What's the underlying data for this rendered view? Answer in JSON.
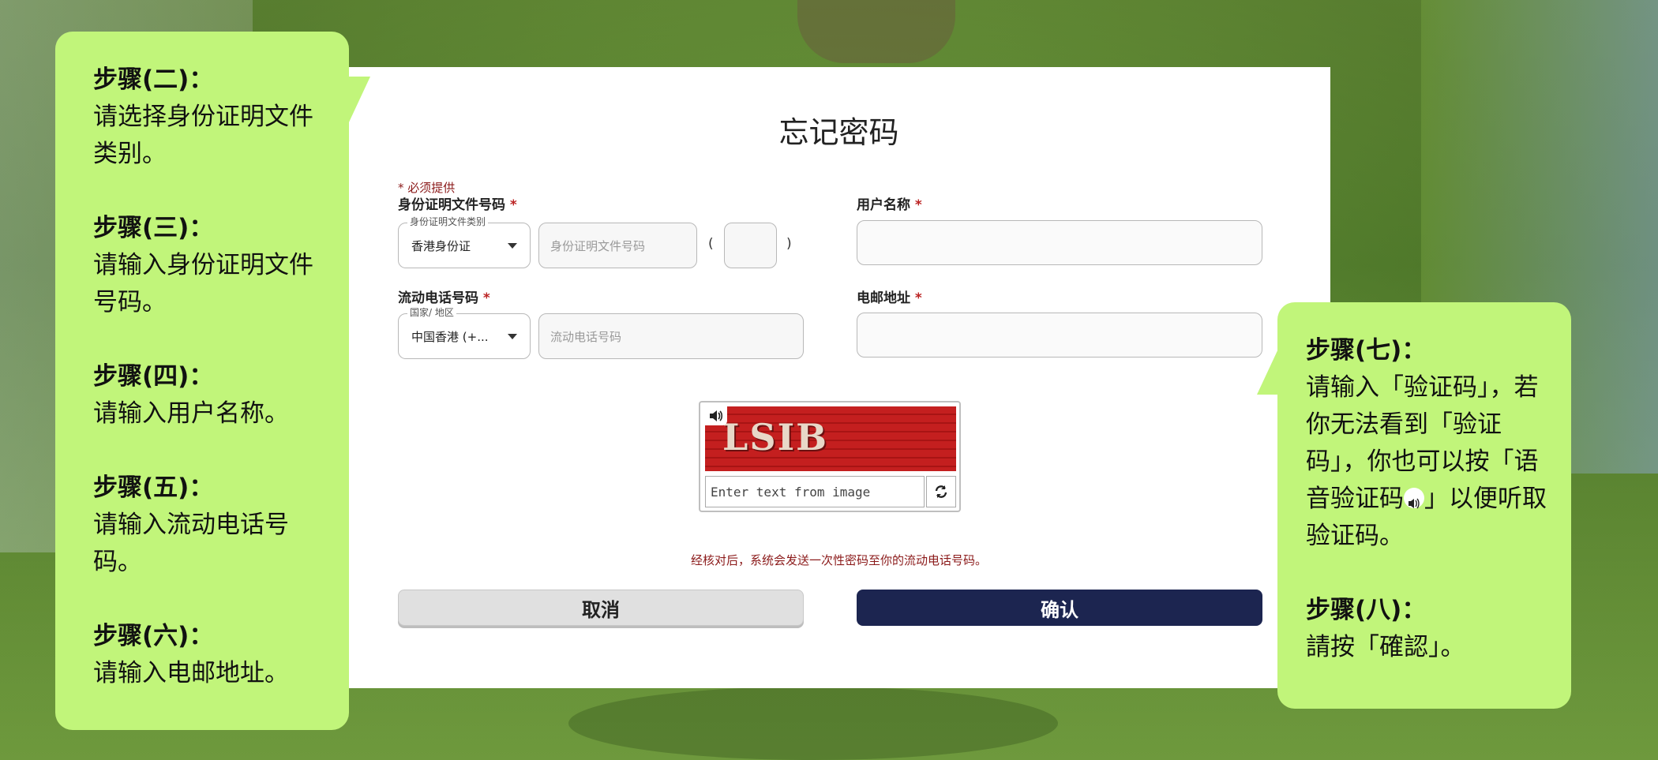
{
  "form": {
    "title": "忘记密码",
    "required_note": "* 必须提供",
    "id_label": "身份证明文件号码",
    "id_type_legend": "身份证明文件类别",
    "id_type_value": "香港身份证",
    "id_number_placeholder": "身份证明文件号码",
    "paren_open": "(",
    "paren_close": ")",
    "username_label": "用户名称",
    "mobile_label": "流动电话号码",
    "region_legend": "国家/ 地区",
    "region_value": "中国香港 (+...",
    "mobile_placeholder": "流动电话号码",
    "email_label": "电邮地址",
    "required_star": "*",
    "captcha_image_text": "LSIB",
    "captcha_placeholder": "Enter text from image",
    "notice": "经核对后，系统会发送一次性密码至你的流动电话号码。",
    "cancel_label": "取消",
    "confirm_label": "确认"
  },
  "instructions_left": [
    {
      "title": "步骤(二)：",
      "text": "请选择身份证明文件类别。"
    },
    {
      "title": "步骤(三)：",
      "text": "请输入身份证明文件号码。"
    },
    {
      "title": "步骤(四)：",
      "text": "请输入用户名称。"
    },
    {
      "title": "步骤(五)：",
      "text": "请输入流动电话号码。"
    },
    {
      "title": "步骤(六)：",
      "text": "请输入电邮地址。"
    }
  ],
  "instructions_right": [
    {
      "title": "步骤(七)：",
      "text_before": "请输入「验证码」，若你无法看到「验证码」，你也可以按「语音验证码",
      "text_after": "」以便听取验证码。"
    },
    {
      "title": "步骤(八)：",
      "text": "請按「確認」。"
    }
  ],
  "colors": {
    "bubble": "#c1f57a",
    "confirm_button": "#1c2550",
    "required": "#b22222"
  },
  "icons": [
    "speaker-icon",
    "refresh-icon",
    "chevron-down-icon"
  ]
}
